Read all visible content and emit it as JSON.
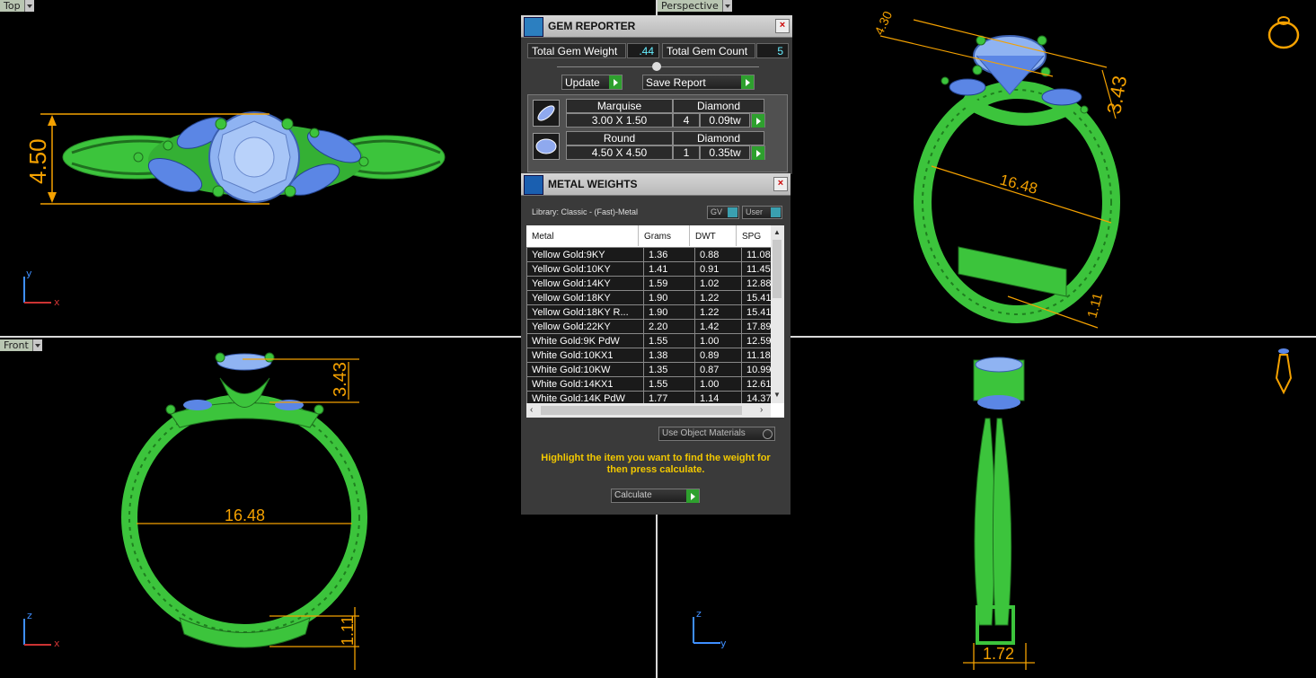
{
  "viewports": {
    "top": {
      "label": "Top",
      "dim_height": "4.50",
      "axis_up": "y",
      "axis_right": "x"
    },
    "perspective": {
      "label": "Perspective",
      "dim_top": "4.30",
      "dim_height": "3.43",
      "dim_inner": "16.48",
      "dim_shank": "1.11"
    },
    "front": {
      "label": "Front",
      "dim_height": "3.43",
      "dim_inner": "16.48",
      "dim_shank": "1.11",
      "axis_up": "z",
      "axis_right": "x"
    },
    "right": {
      "dim_bottom": "1.72",
      "axis_up": "z",
      "axis_right": "y"
    }
  },
  "gem_reporter": {
    "title": "GEM REPORTER",
    "total_weight_label": "Total Gem Weight",
    "total_weight_value": ".44",
    "total_count_label": "Total Gem Count",
    "total_count_value": "5",
    "update_label": "Update",
    "save_report_label": "Save Report",
    "gems": [
      {
        "shape": "Marquise",
        "type": "Diamond",
        "size": "3.00 X 1.50",
        "count": "4",
        "weight": "0.09tw"
      },
      {
        "shape": "Round",
        "type": "Diamond",
        "size": "4.50 X 4.50",
        "count": "1",
        "weight": "0.35tw"
      }
    ]
  },
  "metal_weights": {
    "title": "METAL WEIGHTS",
    "library_label": "Library: Classic - (Fast)-Metal",
    "gv_label": "GV",
    "user_label": "User",
    "columns": [
      "Metal",
      "Grams",
      "DWT",
      "SPG"
    ],
    "rows": [
      [
        "Yellow Gold:9KY",
        "1.36",
        "0.88",
        "11.08"
      ],
      [
        "Yellow Gold:10KY",
        "1.41",
        "0.91",
        "11.45"
      ],
      [
        "Yellow Gold:14KY",
        "1.59",
        "1.02",
        "12.88"
      ],
      [
        "Yellow Gold:18KY",
        "1.90",
        "1.22",
        "15.41"
      ],
      [
        "Yellow Gold:18KY R...",
        "1.90",
        "1.22",
        "15.41"
      ],
      [
        "Yellow Gold:22KY",
        "2.20",
        "1.42",
        "17.89"
      ],
      [
        "White Gold:9K PdW",
        "1.55",
        "1.00",
        "12.59"
      ],
      [
        "White Gold:10KX1",
        "1.38",
        "0.89",
        "11.18"
      ],
      [
        "White Gold:10KW",
        "1.35",
        "0.87",
        "10.99"
      ],
      [
        "White Gold:14KX1",
        "1.55",
        "1.00",
        "12.61"
      ],
      [
        "White Gold:14K PdW",
        "1.77",
        "1.14",
        "14.37"
      ]
    ],
    "use_object_materials_label": "Use Object Materials",
    "hint": "Highlight the item you want to find the weight for then press calculate.",
    "calculate_label": "Calculate"
  },
  "colors": {
    "metal": "#3cc43c",
    "gem": "#5b86e5",
    "dimension": "#f4a100",
    "background": "#000000"
  }
}
